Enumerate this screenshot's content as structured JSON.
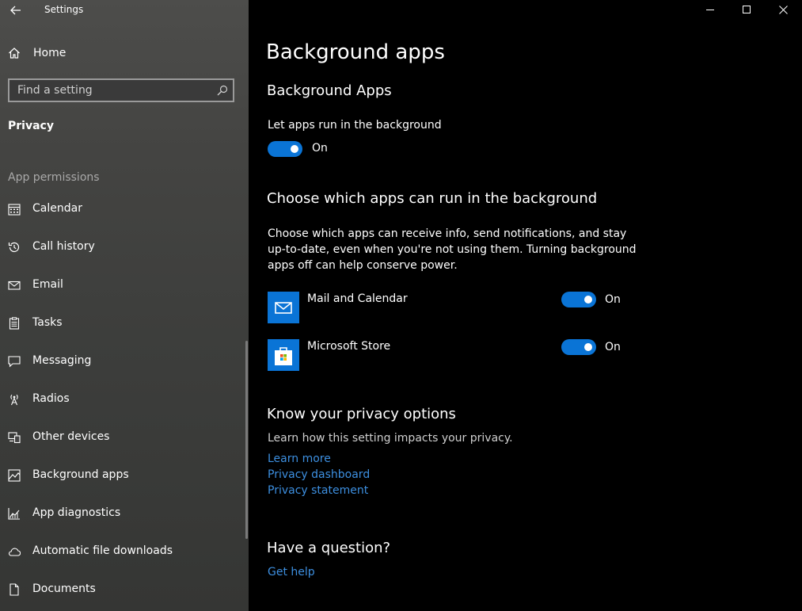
{
  "window": {
    "title": "Settings"
  },
  "sidebar": {
    "home_label": "Home",
    "search_placeholder": "Find a setting",
    "section_title": "Privacy",
    "group_label": "App permissions",
    "items": [
      {
        "label": "Calendar",
        "icon": "calendar-icon"
      },
      {
        "label": "Call history",
        "icon": "history-icon"
      },
      {
        "label": "Email",
        "icon": "email-icon"
      },
      {
        "label": "Tasks",
        "icon": "tasks-icon"
      },
      {
        "label": "Messaging",
        "icon": "messaging-icon"
      },
      {
        "label": "Radios",
        "icon": "radio-tower-icon"
      },
      {
        "label": "Other devices",
        "icon": "devices-icon"
      },
      {
        "label": "Background apps",
        "icon": "background-apps-icon"
      },
      {
        "label": "App diagnostics",
        "icon": "diagnostics-icon"
      },
      {
        "label": "Automatic file downloads",
        "icon": "cloud-icon"
      },
      {
        "label": "Documents",
        "icon": "document-icon"
      }
    ]
  },
  "main": {
    "page_title": "Background apps",
    "background_apps": {
      "heading": "Background Apps",
      "toggle_caption": "Let apps run in the background",
      "toggle_state": "On"
    },
    "choose": {
      "heading": "Choose which apps can run in the background",
      "description_lines": [
        "Choose which apps can receive info, send notifications, and stay",
        "up-to-date, even when you're not using them. Turning background",
        "apps off can help conserve power."
      ],
      "apps": [
        {
          "name": "Mail and Calendar",
          "state": "On",
          "icon": "mail-icon"
        },
        {
          "name": "Microsoft Store",
          "state": "On",
          "icon": "store-icon"
        }
      ]
    },
    "privacy": {
      "heading": "Know your privacy options",
      "description": "Learn how this setting impacts your privacy.",
      "links": [
        "Learn more",
        "Privacy dashboard",
        "Privacy statement"
      ]
    },
    "question": {
      "heading": "Have a question?",
      "link": "Get help"
    }
  },
  "colors": {
    "accent": "#0a74d6",
    "link": "#3d8fe0"
  }
}
